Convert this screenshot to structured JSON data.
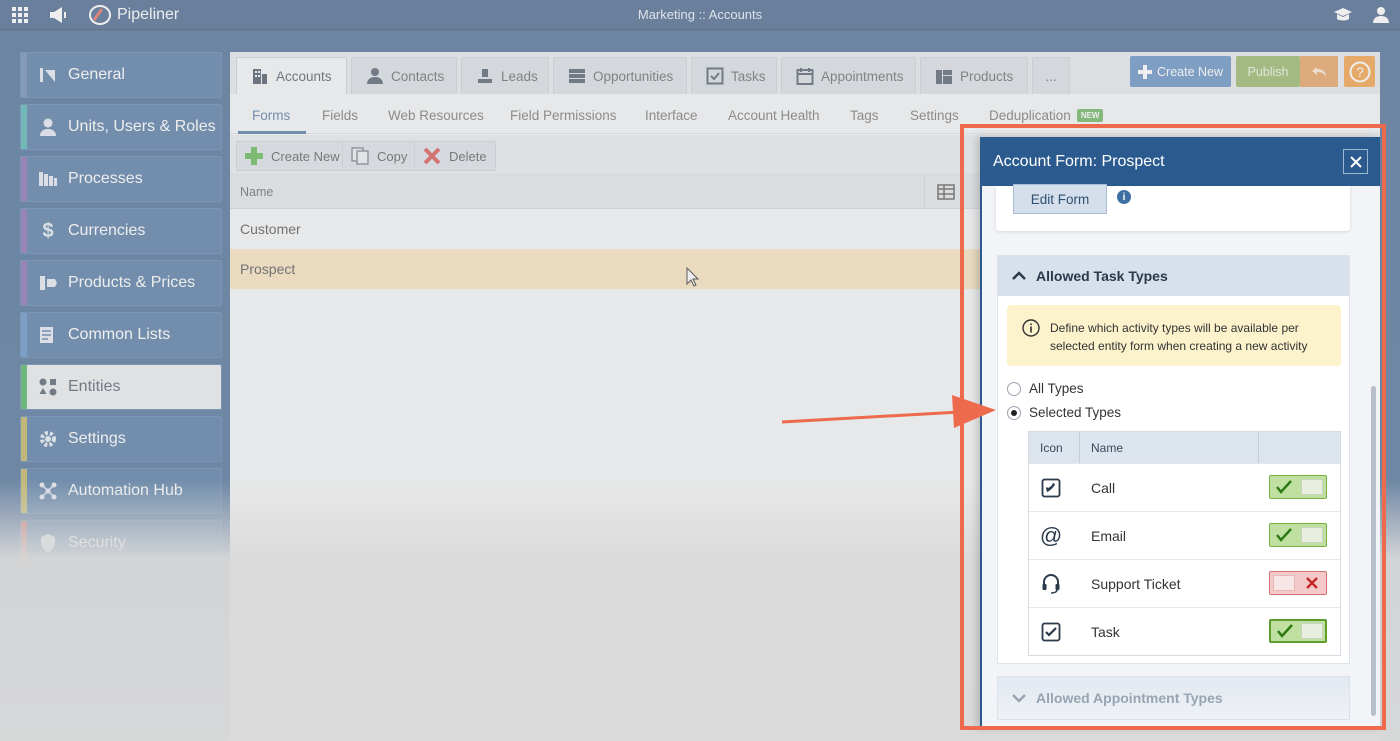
{
  "topbar": {
    "app_name": "Pipeliner",
    "title": "Marketing :: Accounts"
  },
  "sidebar": {
    "items": [
      {
        "label": "General",
        "accent": "#4a6fa0"
      },
      {
        "label": "Units, Users & Roles",
        "accent": "#2aa3a3"
      },
      {
        "label": "Processes",
        "accent": "#6a4aa0"
      },
      {
        "label": "Currencies",
        "accent": "#6a4aa0"
      },
      {
        "label": "Products & Prices",
        "accent": "#6a4aa0"
      },
      {
        "label": "Common Lists",
        "accent": "#3a78b8"
      },
      {
        "label": "Entities",
        "accent": "#26a03c"
      },
      {
        "label": "Settings",
        "accent": "#b0a23a"
      },
      {
        "label": "Automation Hub",
        "accent": "#b0a23a"
      },
      {
        "label": "Security",
        "accent": "#c04a4a"
      }
    ]
  },
  "tabs": [
    "Accounts",
    "Contacts",
    "Leads",
    "Opportunities",
    "Tasks",
    "Appointments",
    "Products",
    "..."
  ],
  "actions": {
    "create_new": "Create New",
    "publish": "Publish"
  },
  "subtabs": [
    "Forms",
    "Fields",
    "Web Resources",
    "Field Permissions",
    "Interface",
    "Account Health",
    "Tags",
    "Settings",
    "Deduplication"
  ],
  "subtab_badge": "NEW",
  "toolbar": {
    "create_new": "Create New",
    "copy": "Copy",
    "delete": "Delete"
  },
  "table": {
    "column": "Name",
    "rows": [
      "Customer",
      "Prospect"
    ]
  },
  "panel": {
    "title": "Account Form: Prospect",
    "edit_form": "Edit Form",
    "section_title": "Allowed Task Types",
    "note": "Define which activity types will be available per selected entity form when creating a new activity",
    "radio_all": "All Types",
    "radio_selected": "Selected Types",
    "table_headers": {
      "icon": "Icon",
      "name": "Name"
    },
    "task_types": [
      {
        "name": "Call",
        "icon": "phone-icon",
        "enabled": true
      },
      {
        "name": "Email",
        "icon": "at-icon",
        "enabled": true
      },
      {
        "name": "Support Ticket",
        "icon": "headset-icon",
        "enabled": false
      },
      {
        "name": "Task",
        "icon": "checkbox-icon",
        "enabled": true
      }
    ],
    "section2_title": "Allowed Appointment Types"
  },
  "colors": {
    "brand": "#2b5a8e",
    "highlight": "#ee6a4c",
    "publish": "#7ea846",
    "help": "#f08a1c"
  }
}
